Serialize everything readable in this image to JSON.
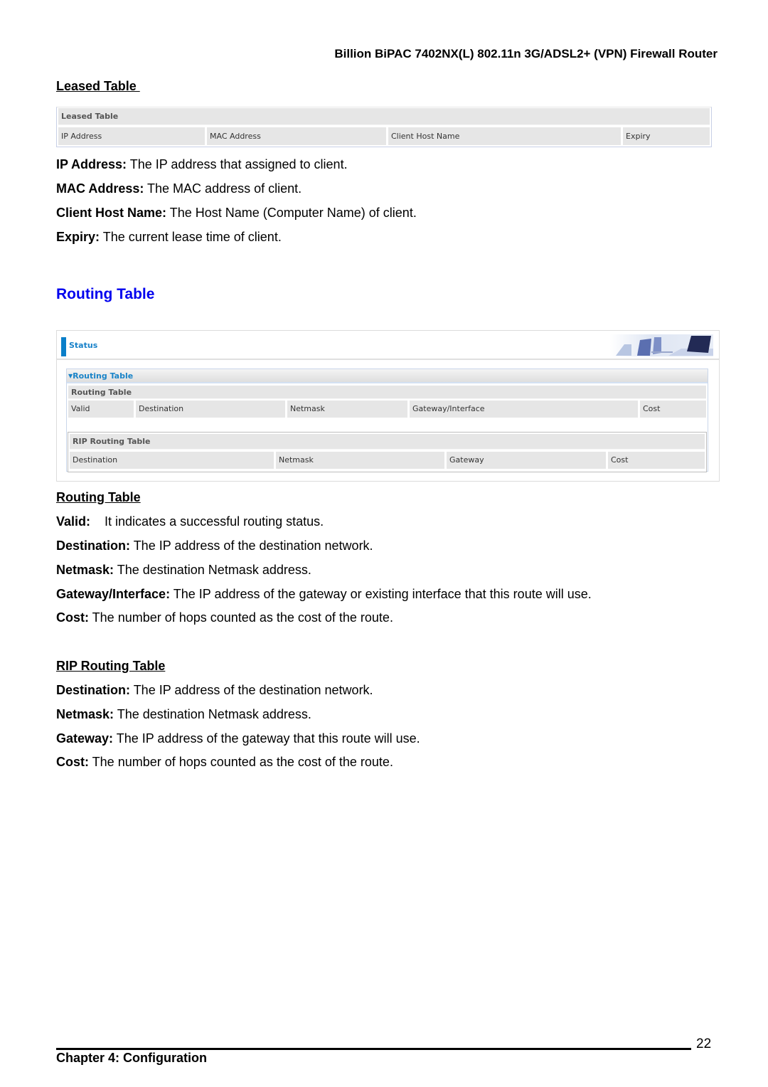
{
  "header": {
    "title": "Billion BiPAC 7402NX(L) 802.11n 3G/ADSL2+ (VPN) Firewall Router"
  },
  "leased_section": {
    "heading": "Leased Table ",
    "table": {
      "title": "Leased Table",
      "columns": [
        "IP Address",
        "MAC Address",
        "Client Host Name",
        "Expiry"
      ]
    },
    "descriptions": [
      {
        "term": "IP Address:",
        "text": " The IP address that assigned to client."
      },
      {
        "term": "MAC Address:",
        "text": " The MAC address of client."
      },
      {
        "term": "Client Host Name:",
        "text": " The Host Name (Computer Name) of client."
      },
      {
        "term": "Expiry:",
        "text": " The current lease time of client."
      }
    ]
  },
  "routing_section": {
    "heading": "Routing Table",
    "screenshot": {
      "status_label": "Status",
      "panel_title": "Routing Table",
      "routing_table": {
        "title": "Routing Table",
        "columns": [
          "Valid",
          "Destination",
          "Netmask",
          "Gateway/Interface",
          "Cost"
        ]
      },
      "rip_table": {
        "title": "RIP Routing Table",
        "columns": [
          "Destination",
          "Netmask",
          "Gateway",
          "Cost"
        ]
      }
    },
    "routing_sub": {
      "heading": "Routing Table",
      "descriptions": [
        {
          "term": "Valid:",
          "text": "    It indicates a successful routing status."
        },
        {
          "term": "Destination:",
          "text": " The IP address of the destination network."
        },
        {
          "term": "Netmask:",
          "text": " The destination Netmask address."
        },
        {
          "term": "Gateway/Interface:",
          "text": " The IP address of the gateway or existing interface that this route will use."
        },
        {
          "term": "Cost:",
          "text": " The number of hops counted as the cost of the route."
        }
      ]
    },
    "rip_sub": {
      "heading": "RIP Routing Table",
      "descriptions": [
        {
          "term": "Destination:",
          "text": " The IP address of the destination network."
        },
        {
          "term": "Netmask:",
          "text": " The destination Netmask address."
        },
        {
          "term": "Gateway:",
          "text": " The IP address of the gateway that this route will use."
        },
        {
          "term": "Cost:",
          "text": " The number of hops counted as the cost of the route."
        }
      ]
    }
  },
  "footer": {
    "chapter": "Chapter 4: Configuration",
    "page_number": "22"
  },
  "colors": {
    "heading_blue": "#0000ee",
    "ui_accent": "#0a7fc9",
    "ui_cell": "#e6e6e6"
  }
}
